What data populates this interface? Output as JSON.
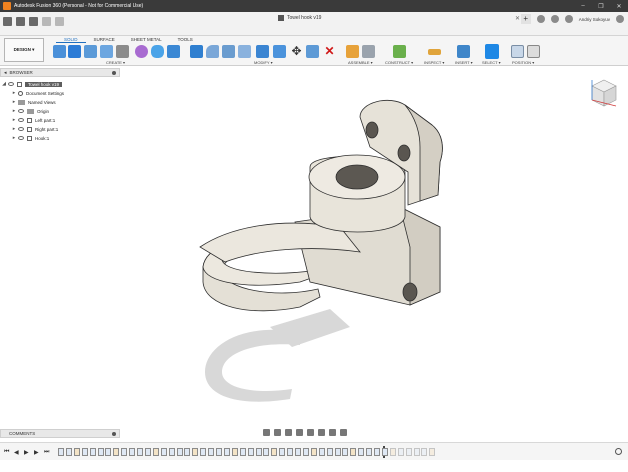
{
  "window": {
    "title": "Autodesk Fusion 360 (Personal - Not for Commercial Use)",
    "controls": [
      "–",
      "❐",
      "✕"
    ]
  },
  "document": {
    "tab_name": "Towel hook v19",
    "close": "✕",
    "user": "Andriy Sokoyuv"
  },
  "ribbon": {
    "workspace": "DESIGN ▾",
    "tabs": [
      "SOLID",
      "SURFACE",
      "SHEET METAL",
      "TOOLS"
    ],
    "active_tab": "SOLID",
    "groups": [
      "CREATE ▾",
      "MODIFY ▾",
      "ASSEMBLE ▾",
      "CONSTRUCT ▾",
      "INSPECT ▾",
      "INSERT ▾",
      "SELECT ▾",
      "POSITION ▾"
    ]
  },
  "browser": {
    "header": "BROWSER",
    "items": [
      {
        "label": "Towel hook v19",
        "selected": true
      },
      {
        "label": "Document Settings"
      },
      {
        "label": "Named Views"
      },
      {
        "label": "Origin"
      },
      {
        "label": "Left part:1"
      },
      {
        "label": "Right part:1"
      },
      {
        "label": "Hook:1"
      }
    ]
  },
  "comments": {
    "label": "COMMENTS"
  },
  "colors": {
    "accent": "#1f6fbf",
    "model_fill": "#e8e4dc",
    "model_edge": "#3a3a3a",
    "shadow": "#d6d6d6",
    "titlebar": "#3a3a3a"
  }
}
